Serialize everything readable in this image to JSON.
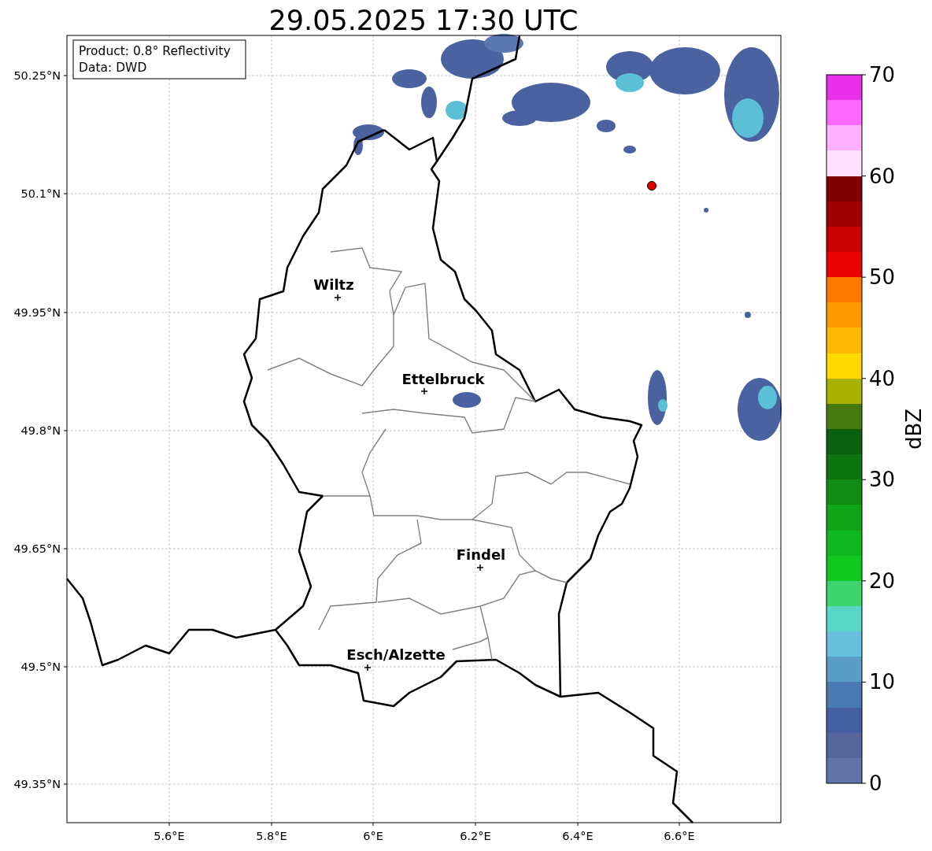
{
  "title": "29.05.2025 17:30 UTC",
  "info_box": [
    "Product: 0.8° Reflectivity",
    "Data: DWD"
  ],
  "y_ticks": [
    "50.25°N",
    "50.1°N",
    "49.95°N",
    "49.8°N",
    "49.65°N",
    "49.5°N",
    "49.35°N"
  ],
  "x_ticks": [
    "5.6°E",
    "5.8°E",
    "6°E",
    "6.2°E",
    "6.4°E",
    "6.6°E"
  ],
  "cities": [
    {
      "name": "Wiltz"
    },
    {
      "name": "Ettelbruck"
    },
    {
      "name": "Findel"
    },
    {
      "name": "Esch/Alzette"
    }
  ],
  "colorbar": {
    "label": "dBZ",
    "ticks": [
      "70",
      "60",
      "50",
      "40",
      "30",
      "20",
      "10",
      "0"
    ]
  }
}
